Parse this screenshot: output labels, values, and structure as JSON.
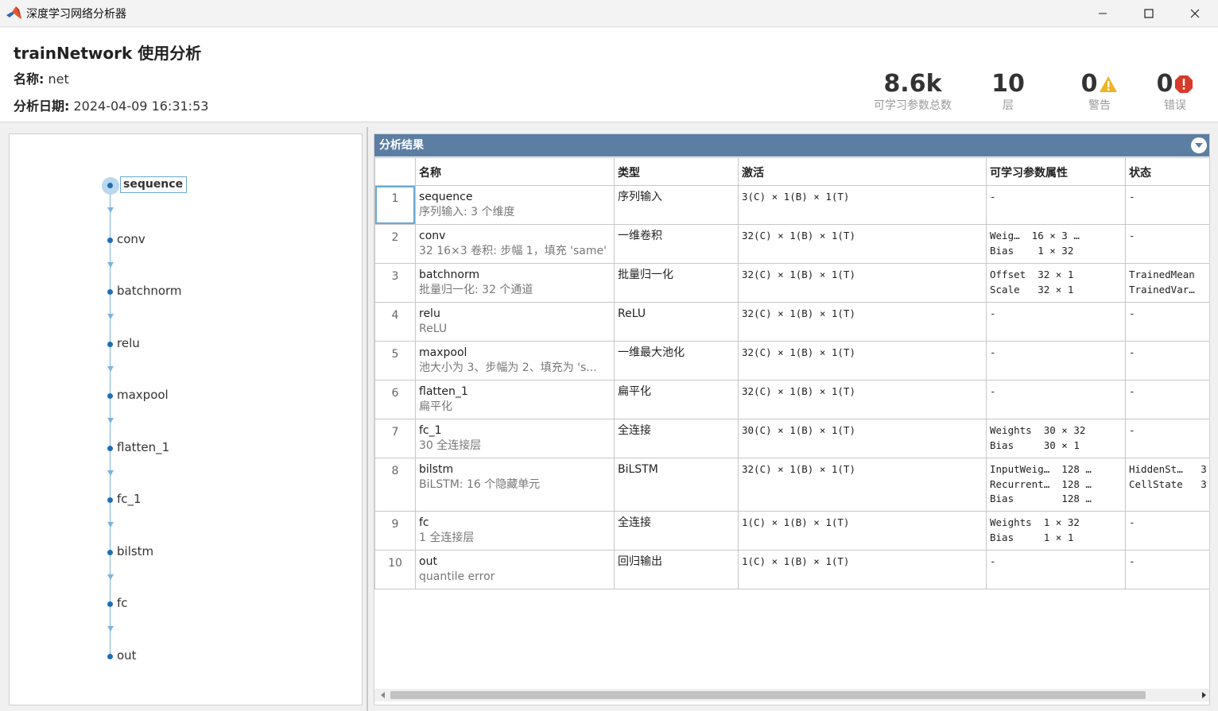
{
  "window": {
    "title": "深度学习网络分析器",
    "controls": [
      "minimize-icon",
      "maximize-icon",
      "close-icon"
    ]
  },
  "header": {
    "title": "trainNetwork 使用分析",
    "name_label": "名称:",
    "name_value": "net",
    "date_label": "分析日期:",
    "date_value": "2024-04-09 16:31:53",
    "stats": {
      "params": {
        "value": "8.6k",
        "label": "可学习参数总数"
      },
      "layers": {
        "value": "10",
        "label": "层"
      },
      "warnings": {
        "value": "0",
        "label": "警告",
        "icon": "warning-icon",
        "color": "#f0b323"
      },
      "errors": {
        "value": "0",
        "label": "错误",
        "icon": "error-icon",
        "color": "#d63b2b"
      }
    }
  },
  "graph": {
    "nodes": [
      "sequence",
      "conv",
      "batchnorm",
      "relu",
      "maxpool",
      "flatten_1",
      "fc_1",
      "bilstm",
      "fc",
      "out"
    ],
    "selected": "sequence"
  },
  "results": {
    "title": "分析结果",
    "columns": [
      "",
      "名称",
      "类型",
      "激活",
      "可学习参数属性",
      "状态"
    ],
    "rows": [
      {
        "idx": "1",
        "name": "sequence",
        "desc": "序列输入: 3 个维度",
        "type": "序列输入",
        "activation": "3(C) × 1(B) × 1(T)",
        "params": [
          "-"
        ],
        "state": [
          "-"
        ]
      },
      {
        "idx": "2",
        "name": "conv",
        "desc": "32 16×3 卷积: 步幅 1，填充 'same'",
        "type": "一维卷积",
        "activation": "32(C) × 1(B) × 1(T)",
        "params": [
          "Weig…  16 × 3 …",
          "Bias    1 × 32"
        ],
        "state": [
          "-"
        ]
      },
      {
        "idx": "3",
        "name": "batchnorm",
        "desc": "批量归一化: 32 个通道",
        "type": "批量归一化",
        "activation": "32(C) × 1(B) × 1(T)",
        "params": [
          "Offset  32 × 1",
          "Scale   32 × 1"
        ],
        "state": [
          "TrainedMean",
          "TrainedVar…"
        ]
      },
      {
        "idx": "4",
        "name": "relu",
        "desc": "ReLU",
        "type": "ReLU",
        "activation": "32(C) × 1(B) × 1(T)",
        "params": [
          "-"
        ],
        "state": [
          "-"
        ]
      },
      {
        "idx": "5",
        "name": "maxpool",
        "desc": "池大小为 3、步幅为 2、填充为 's...",
        "type": "一维最大池化",
        "activation": "32(C) × 1(B) × 1(T)",
        "params": [
          "-"
        ],
        "state": [
          "-"
        ]
      },
      {
        "idx": "6",
        "name": "flatten_1",
        "desc": "扁平化",
        "type": "扁平化",
        "activation": "32(C) × 1(B) × 1(T)",
        "params": [
          "-"
        ],
        "state": [
          "-"
        ]
      },
      {
        "idx": "7",
        "name": "fc_1",
        "desc": "30 全连接层",
        "type": "全连接",
        "activation": "30(C) × 1(B) × 1(T)",
        "params": [
          "Weights  30 × 32",
          "Bias     30 × 1"
        ],
        "state": [
          "-"
        ]
      },
      {
        "idx": "8",
        "name": "bilstm",
        "desc": "BiLSTM: 16 个隐藏单元",
        "type": "BiLSTM",
        "activation": "32(C) × 1(B) × 1(T)",
        "params": [
          "InputWeig…  128 …",
          "Recurrent…  128 …",
          "Bias        128 …"
        ],
        "state": [
          "HiddenSt…   3",
          "CellState   3"
        ]
      },
      {
        "idx": "9",
        "name": "fc",
        "desc": "1 全连接层",
        "type": "全连接",
        "activation": "1(C) × 1(B) × 1(T)",
        "params": [
          "Weights  1 × 32",
          "Bias     1 × 1"
        ],
        "state": [
          "-"
        ]
      },
      {
        "idx": "10",
        "name": "out",
        "desc": "quantile error",
        "type": "回归输出",
        "activation": "1(C) × 1(B) × 1(T)",
        "params": [
          "-"
        ],
        "state": [
          "-"
        ]
      }
    ],
    "selected_row": "1"
  }
}
